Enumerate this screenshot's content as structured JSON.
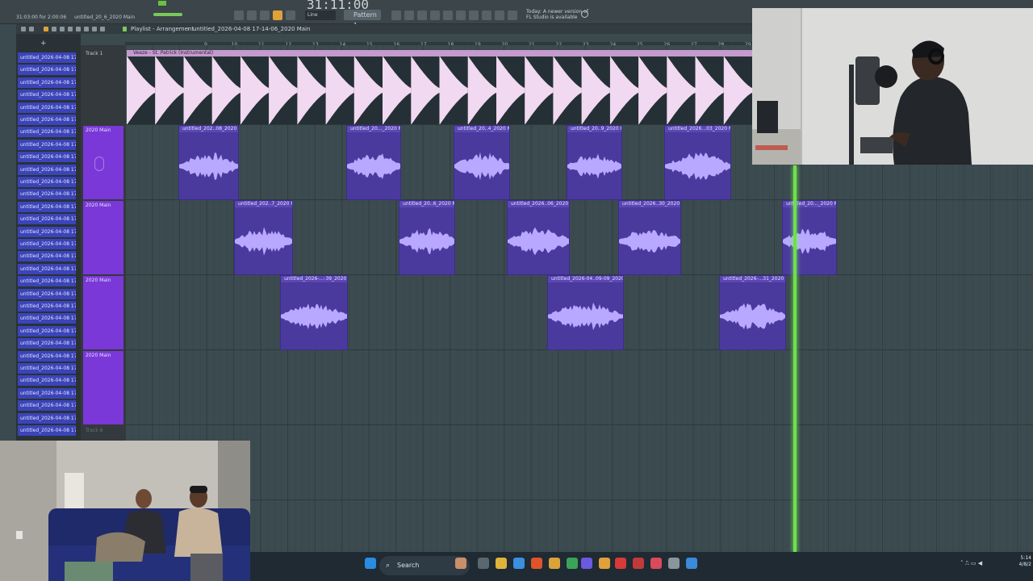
{
  "topbar": {
    "time": "31:11:00",
    "info_line1": "31:03:00 for 2:00:06",
    "info_line2": "untitled_20_6_2020 Main",
    "snap_mode": "Line",
    "pattern": "Pattern 1",
    "update_line1": "Today: A newer version of",
    "update_line2": "FL Studio is available"
  },
  "nav": {
    "title": "Playlist - Arrangement",
    "separator": "›",
    "project": "untitled_2026-04-08 17-14-06_2020 Main"
  },
  "browser": {
    "item_label": "untitled_2026-04-08 17-",
    "count": 31
  },
  "ruler": {
    "marks": [
      "9",
      "10",
      "11",
      "12",
      "13",
      "14",
      "15",
      "16",
      "17",
      "18",
      "19",
      "20",
      "21",
      "22",
      "23",
      "24",
      "25",
      "26",
      "27",
      "28",
      "29"
    ]
  },
  "tracks": [
    {
      "label": "Track 1"
    },
    {
      "label": "2020 Main"
    },
    {
      "label": "2020 Main"
    },
    {
      "label": "2020 Main"
    },
    {
      "label": "2020 Main"
    },
    {
      "label": "Track 6"
    }
  ],
  "top_clip": {
    "title": "Veeze - St. Patrick (Instrumental)"
  },
  "clips_row1": [
    {
      "title": "untitled_202..08_2020 Main"
    },
    {
      "title": "untitled_20..._2020 Main"
    },
    {
      "title": "untitled_20..4_2020 Main"
    },
    {
      "title": "untitled_20..9_2020 Main"
    },
    {
      "title": "untitled_2026...03_2020 Main"
    }
  ],
  "clips_row2": [
    {
      "title": "untitled_202..7_2020 Main"
    },
    {
      "title": "untitled_20..6_2020 Main"
    },
    {
      "title": "untitled_2026..06_2020 Main"
    },
    {
      "title": "untitled_2026..30_2020 Main"
    },
    {
      "title": "untitled_20..._2020 Main"
    }
  ],
  "clips_row3": [
    {
      "title": "untitled_2026-...-39_2020 Main"
    },
    {
      "title": "untitled_2026-04..09-09_2020 Main"
    },
    {
      "title": "untitled_2026-...31_2020 Main"
    }
  ],
  "taskbar": {
    "search_placeholder": "Search",
    "time": "5:14",
    "date": "4/8/2"
  },
  "colors": {
    "clip": "#4a3a9e",
    "waveform": "#b9a8ff",
    "top_clip_wave": "#f1d9f2",
    "playhead": "#6fe04a",
    "browser_item": "#3b44b8"
  }
}
